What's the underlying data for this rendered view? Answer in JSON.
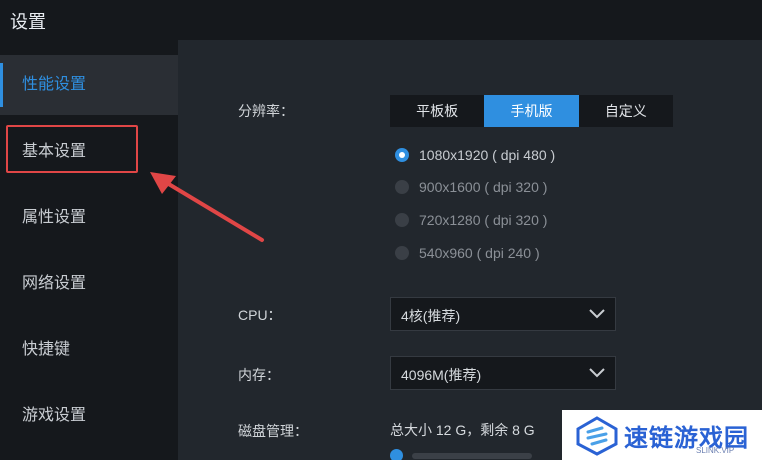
{
  "window": {
    "title": "设置"
  },
  "sidebar": {
    "items": [
      {
        "label": "性能设置",
        "active": true
      },
      {
        "label": "基本设置",
        "active": false
      },
      {
        "label": "属性设置",
        "active": false
      },
      {
        "label": "网络设置",
        "active": false
      },
      {
        "label": "快捷键",
        "active": false
      },
      {
        "label": "游戏设置",
        "active": false
      }
    ]
  },
  "resolution": {
    "label": "分辨率：",
    "modes": [
      "平板板",
      "手机版",
      "自定义"
    ],
    "selected_mode": "手机版",
    "options": [
      "1080x1920 ( dpi 480 )",
      "900x1600 ( dpi 320 )",
      "720x1280 ( dpi 320 )",
      "540x960 ( dpi 240 )"
    ],
    "selected_option": "1080x1920 ( dpi 480 )"
  },
  "cpu": {
    "label": "CPU：",
    "value": "4核(推荐)"
  },
  "memory": {
    "label": "内存：",
    "value": "4096M(推荐)"
  },
  "disk": {
    "label": "磁盘管理：",
    "value": "总大小 12 G，剩余 8 G"
  },
  "watermark": {
    "text": "速链游戏园",
    "sub": "SLINK.VIP"
  },
  "colors": {
    "accent": "#2f8fe0",
    "highlight": "#e04646",
    "background": "#1f2328"
  }
}
